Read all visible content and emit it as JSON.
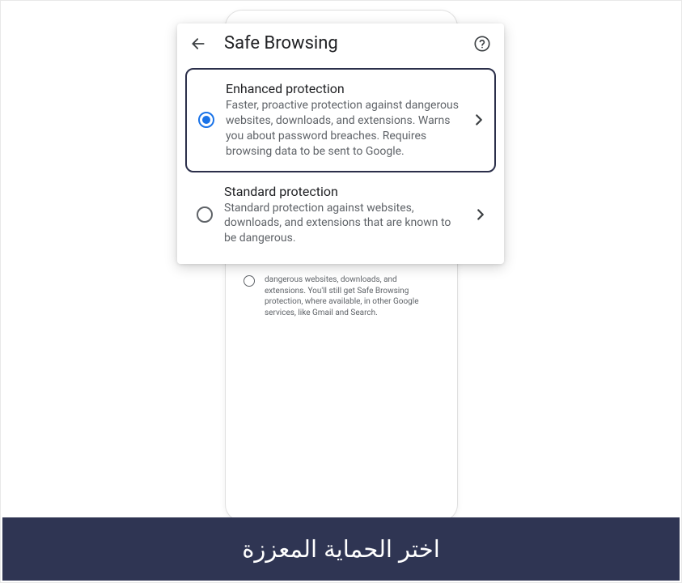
{
  "header": {
    "title": "Safe Browsing"
  },
  "options": {
    "enhanced": {
      "title": "Enhanced protection",
      "desc": "Faster, proactive protection against dangerous websites, downloads, and extensions. Warns you about password breaches. Requires browsing data to be sent to Google."
    },
    "standard": {
      "title": "Standard protection",
      "desc": "Standard protection against websites, downloads, and extensions that are known to be dangerous."
    }
  },
  "background_option": {
    "desc": "dangerous websites, downloads, and extensions. You'll still get Safe Browsing protection, where available, in other Google services, like Gmail and Search."
  },
  "caption": "اختر الحماية المعززة"
}
